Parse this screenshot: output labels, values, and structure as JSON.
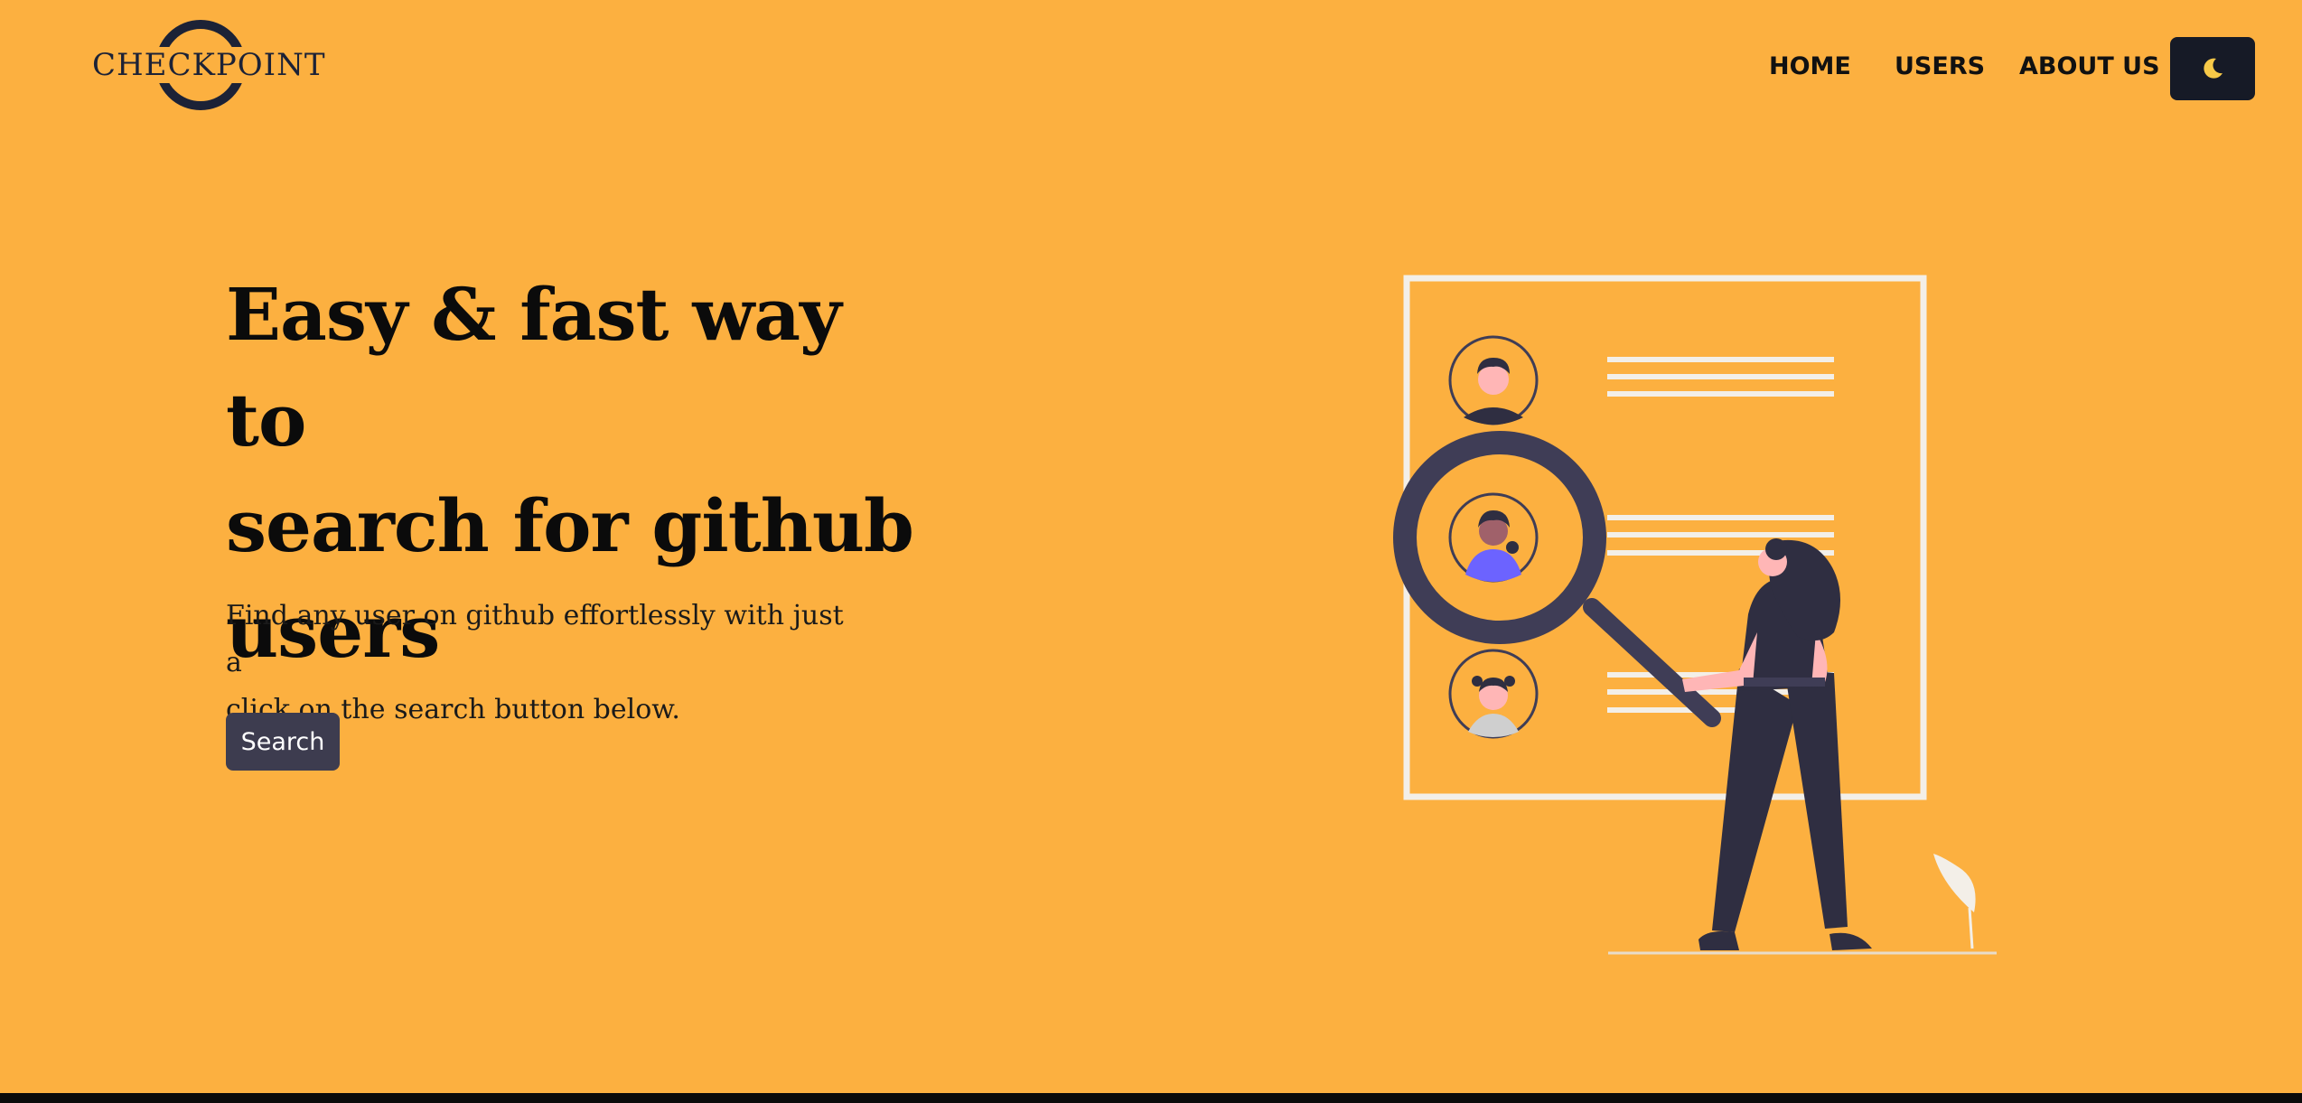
{
  "header": {
    "logo_text": "CHECKPOINT",
    "nav": [
      {
        "label": "HOME"
      },
      {
        "label": "USERS"
      },
      {
        "label": "ABOUT US"
      }
    ],
    "theme_toggle_icon": "moon-icon"
  },
  "hero": {
    "title_lines": [
      "Easy & fast way to",
      "search for github",
      "users"
    ],
    "subtitle_lines": [
      "Find any user on github effortlessly with just a",
      "click on the search button below."
    ],
    "search_label": "Search"
  },
  "colors": {
    "background": "#fcb040",
    "dark": "#161a26",
    "button": "#3d3c4f",
    "accent_purple": "#6c63ff"
  }
}
